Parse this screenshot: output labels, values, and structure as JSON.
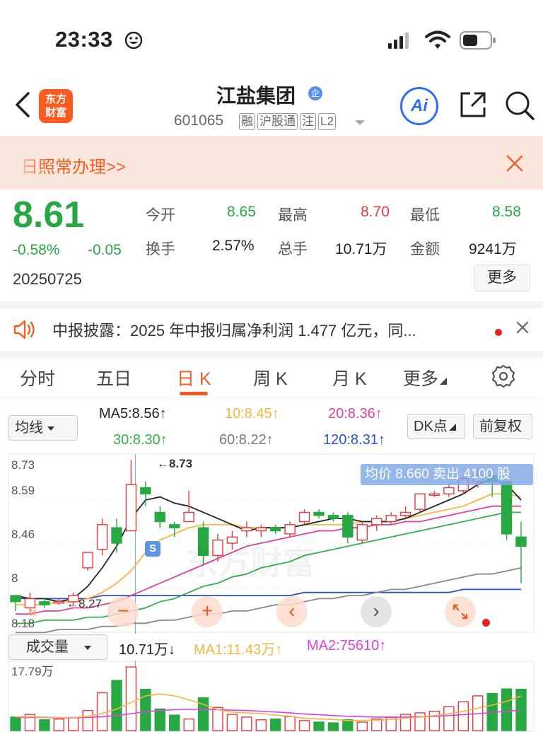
{
  "status": {
    "time": "23:33"
  },
  "header": {
    "logo_line1": "东方",
    "logo_line2": "财富",
    "title": "江盐集团",
    "title_badge": "企",
    "code": "601065",
    "tags": [
      "融",
      "沪股通",
      "注",
      "L2"
    ],
    "ai_label": "Ai"
  },
  "banner": {
    "text": "日照常办理>>"
  },
  "quote": {
    "price": "8.61",
    "change_pct": "-0.58%",
    "change_abs": "-0.05",
    "date": "20250725",
    "open_label": "今开",
    "open": "8.65",
    "high_label": "最高",
    "high": "8.70",
    "low_label": "最低",
    "low": "8.58",
    "turnover_label": "换手",
    "turnover": "2.57%",
    "volume_label": "总手",
    "volume": "10.71万",
    "amount_label": "金额",
    "amount": "9241万",
    "more": "更多"
  },
  "notice": {
    "text": "中报披露：2025 年中报归属净利润 1.477 亿元，同..."
  },
  "tabs": [
    "分时",
    "五日",
    "日 K",
    "周 K",
    "月 K",
    "更多"
  ],
  "active_tab": "日 K",
  "ma": {
    "select": "均线",
    "ma5": "MA5:8.56↑",
    "ma10": "10:8.45↑",
    "ma20": "20:8.36↑",
    "ma30": "30:8.30↑",
    "ma60": "60:8.22↑",
    "ma120": "120:8.31↑",
    "dk": "DK点",
    "fq": "前复权"
  },
  "colors": {
    "up": "#e83a3a",
    "down": "#27a842",
    "ma5": "#222222",
    "ma10": "#f5b640",
    "ma20": "#e040a0",
    "ma30": "#32b04a",
    "ma60": "#888888",
    "ma120": "#2a4fd0"
  },
  "chart": {
    "y_ticks": [
      "8.73",
      "8.59",
      "8.46",
      "8",
      "8.18"
    ],
    "high_marker": "8.73",
    "low_marker": "8.27",
    "tooltip": "均价 8.660  卖出 4100 股",
    "s_marker": "S",
    "watermark": "东方财富"
  },
  "chart_data": {
    "type": "candlestick",
    "y_range": [
      8.18,
      8.74
    ],
    "candles": [
      {
        "o": 8.29,
        "c": 8.27,
        "h": 8.29,
        "l": 8.24
      },
      {
        "o": 8.25,
        "c": 8.28,
        "h": 8.3,
        "l": 8.23
      },
      {
        "o": 8.27,
        "c": 8.26,
        "h": 8.28,
        "l": 8.25
      },
      {
        "o": 8.27,
        "c": 8.27,
        "h": 8.28,
        "l": 8.26
      },
      {
        "o": 8.27,
        "c": 8.29,
        "h": 8.3,
        "l": 8.26
      },
      {
        "o": 8.38,
        "c": 8.43,
        "h": 8.43,
        "l": 8.37
      },
      {
        "o": 8.44,
        "c": 8.52,
        "h": 8.54,
        "l": 8.42
      },
      {
        "o": 8.51,
        "c": 8.46,
        "h": 8.54,
        "l": 8.43
      },
      {
        "o": 8.5,
        "c": 8.65,
        "h": 8.73,
        "l": 8.5
      },
      {
        "o": 8.64,
        "c": 8.62,
        "h": 8.66,
        "l": 8.58
      },
      {
        "o": 8.56,
        "c": 8.53,
        "h": 8.58,
        "l": 8.51
      },
      {
        "o": 8.52,
        "c": 8.51,
        "h": 8.53,
        "l": 8.48
      },
      {
        "o": 8.53,
        "c": 8.56,
        "h": 8.63,
        "l": 8.53
      },
      {
        "o": 8.51,
        "c": 8.42,
        "h": 8.53,
        "l": 8.39
      },
      {
        "o": 8.42,
        "c": 8.47,
        "h": 8.49,
        "l": 8.4
      },
      {
        "o": 8.46,
        "c": 8.48,
        "h": 8.5,
        "l": 8.44
      },
      {
        "o": 8.5,
        "c": 8.51,
        "h": 8.53,
        "l": 8.48
      },
      {
        "o": 8.5,
        "c": 8.51,
        "h": 8.52,
        "l": 8.48
      },
      {
        "o": 8.51,
        "c": 8.5,
        "h": 8.52,
        "l": 8.49
      },
      {
        "o": 8.49,
        "c": 8.52,
        "h": 8.53,
        "l": 8.48
      },
      {
        "o": 8.53,
        "c": 8.56,
        "h": 8.57,
        "l": 8.52
      },
      {
        "o": 8.56,
        "c": 8.55,
        "h": 8.57,
        "l": 8.54
      },
      {
        "o": 8.55,
        "c": 8.54,
        "h": 8.56,
        "l": 8.53
      },
      {
        "o": 8.55,
        "c": 8.48,
        "h": 8.56,
        "l": 8.46
      },
      {
        "o": 8.47,
        "c": 8.52,
        "h": 8.53,
        "l": 8.46
      },
      {
        "o": 8.52,
        "c": 8.54,
        "h": 8.55,
        "l": 8.5
      },
      {
        "o": 8.53,
        "c": 8.55,
        "h": 8.56,
        "l": 8.52
      },
      {
        "o": 8.55,
        "c": 8.56,
        "h": 8.58,
        "l": 8.54
      },
      {
        "o": 8.57,
        "c": 8.62,
        "h": 8.62,
        "l": 8.56
      },
      {
        "o": 8.62,
        "c": 8.62,
        "h": 8.63,
        "l": 8.61
      },
      {
        "o": 8.62,
        "c": 8.64,
        "h": 8.65,
        "l": 8.61
      },
      {
        "o": 8.63,
        "c": 8.67,
        "h": 8.68,
        "l": 8.62
      },
      {
        "o": 8.66,
        "c": 8.68,
        "h": 8.7,
        "l": 8.64
      },
      {
        "o": 8.68,
        "c": 8.66,
        "h": 8.7,
        "l": 8.61
      },
      {
        "o": 8.66,
        "c": 8.49,
        "h": 8.67,
        "l": 8.47
      },
      {
        "o": 8.48,
        "c": 8.45,
        "h": 8.53,
        "l": 8.33
      }
    ],
    "ma5": [
      8.29,
      8.28,
      8.28,
      8.27,
      8.28,
      8.32,
      8.38,
      8.45,
      8.54,
      8.6,
      8.61,
      8.59,
      8.58,
      8.56,
      8.54,
      8.52,
      8.5,
      8.51,
      8.51,
      8.51,
      8.52,
      8.53,
      8.54,
      8.54,
      8.53,
      8.53,
      8.53,
      8.54,
      8.56,
      8.58,
      8.6,
      8.62,
      8.65,
      8.67,
      8.65,
      8.6
    ],
    "ma10": [
      8.26,
      8.26,
      8.26,
      8.27,
      8.27,
      8.28,
      8.3,
      8.33,
      8.37,
      8.43,
      8.47,
      8.49,
      8.51,
      8.52,
      8.52,
      8.52,
      8.51,
      8.51,
      8.51,
      8.51,
      8.52,
      8.52,
      8.52,
      8.52,
      8.53,
      8.53,
      8.53,
      8.54,
      8.55,
      8.56,
      8.57,
      8.58,
      8.6,
      8.62,
      8.62,
      8.61
    ],
    "ma20": [
      8.23,
      8.23,
      8.24,
      8.24,
      8.25,
      8.25,
      8.26,
      8.27,
      8.29,
      8.31,
      8.33,
      8.35,
      8.37,
      8.39,
      8.41,
      8.43,
      8.45,
      8.46,
      8.47,
      8.48,
      8.49,
      8.5,
      8.5,
      8.51,
      8.51,
      8.52,
      8.52,
      8.53,
      8.53,
      8.54,
      8.55,
      8.56,
      8.57,
      8.58,
      8.58,
      8.58
    ],
    "ma30": [
      8.2,
      8.2,
      8.21,
      8.21,
      8.21,
      8.22,
      8.22,
      8.23,
      8.24,
      8.25,
      8.27,
      8.28,
      8.3,
      8.32,
      8.33,
      8.35,
      8.36,
      8.38,
      8.39,
      8.4,
      8.42,
      8.43,
      8.44,
      8.45,
      8.46,
      8.47,
      8.48,
      8.49,
      8.5,
      8.51,
      8.52,
      8.53,
      8.54,
      8.55,
      8.56,
      8.56
    ],
    "ma60": [
      8.17,
      8.17,
      8.17,
      8.18,
      8.18,
      8.18,
      8.19,
      8.19,
      8.2,
      8.2,
      8.21,
      8.21,
      8.22,
      8.23,
      8.23,
      8.24,
      8.24,
      8.25,
      8.26,
      8.26,
      8.27,
      8.28,
      8.28,
      8.29,
      8.29,
      8.3,
      8.31,
      8.31,
      8.32,
      8.33,
      8.34,
      8.35,
      8.36,
      8.36,
      8.37,
      8.38
    ],
    "ma120": [
      8.28,
      8.28,
      8.28,
      8.28,
      8.28,
      8.28,
      8.29,
      8.29,
      8.29,
      8.29,
      8.29,
      8.29,
      8.29,
      8.29,
      8.29,
      8.29,
      8.29,
      8.29,
      8.29,
      8.29,
      8.3,
      8.3,
      8.3,
      8.3,
      8.3,
      8.3,
      8.3,
      8.3,
      8.3,
      8.3,
      8.3,
      8.31,
      8.31,
      8.31,
      8.31,
      8.31
    ],
    "volume_range": [
      0,
      17.79
    ],
    "volume": [
      3.5,
      4.2,
      2.8,
      3.0,
      3.4,
      5.2,
      9.8,
      13.0,
      16.5,
      10.7,
      5.6,
      4.0,
      3.0,
      8.5,
      6.0,
      4.2,
      3.5,
      2.8,
      3.0,
      3.6,
      2.6,
      2.2,
      2.0,
      2.8,
      2.2,
      3.0,
      3.4,
      4.2,
      4.6,
      5.0,
      6.2,
      7.5,
      9.0,
      9.6,
      10.8,
      10.71
    ],
    "vol_ma1": [
      3.6,
      3.6,
      3.5,
      3.4,
      3.4,
      3.7,
      4.5,
      5.6,
      7.3,
      9.0,
      9.5,
      9.0,
      8.0,
      6.8,
      5.4,
      4.8,
      4.6,
      4.4,
      4.0,
      3.7,
      3.2,
      3.0,
      2.9,
      2.6,
      2.6,
      2.7,
      2.9,
      3.2,
      3.5,
      3.9,
      4.4,
      5.0,
      5.8,
      6.6,
      7.6,
      9.0
    ],
    "vol_ma2": [
      3.4,
      3.4,
      3.4,
      3.3,
      3.3,
      3.4,
      3.6,
      3.9,
      4.4,
      4.9,
      5.2,
      5.4,
      5.5,
      5.5,
      5.4,
      5.3,
      5.2,
      5.0,
      4.8,
      4.6,
      4.3,
      4.1,
      3.9,
      3.7,
      3.6,
      3.5,
      3.5,
      3.5,
      3.6,
      3.7,
      3.9,
      4.1,
      4.4,
      4.7,
      5.0,
      5.3
    ]
  },
  "vol": {
    "select": "成交量",
    "current": "10.71万↓",
    "ma1": "MA1:11.43万↑",
    "ma2": "MA2:75610↑",
    "max_label": "17.79万"
  },
  "controls": {
    "minus": "−",
    "plus": "+",
    "left": "‹",
    "right": "›"
  }
}
